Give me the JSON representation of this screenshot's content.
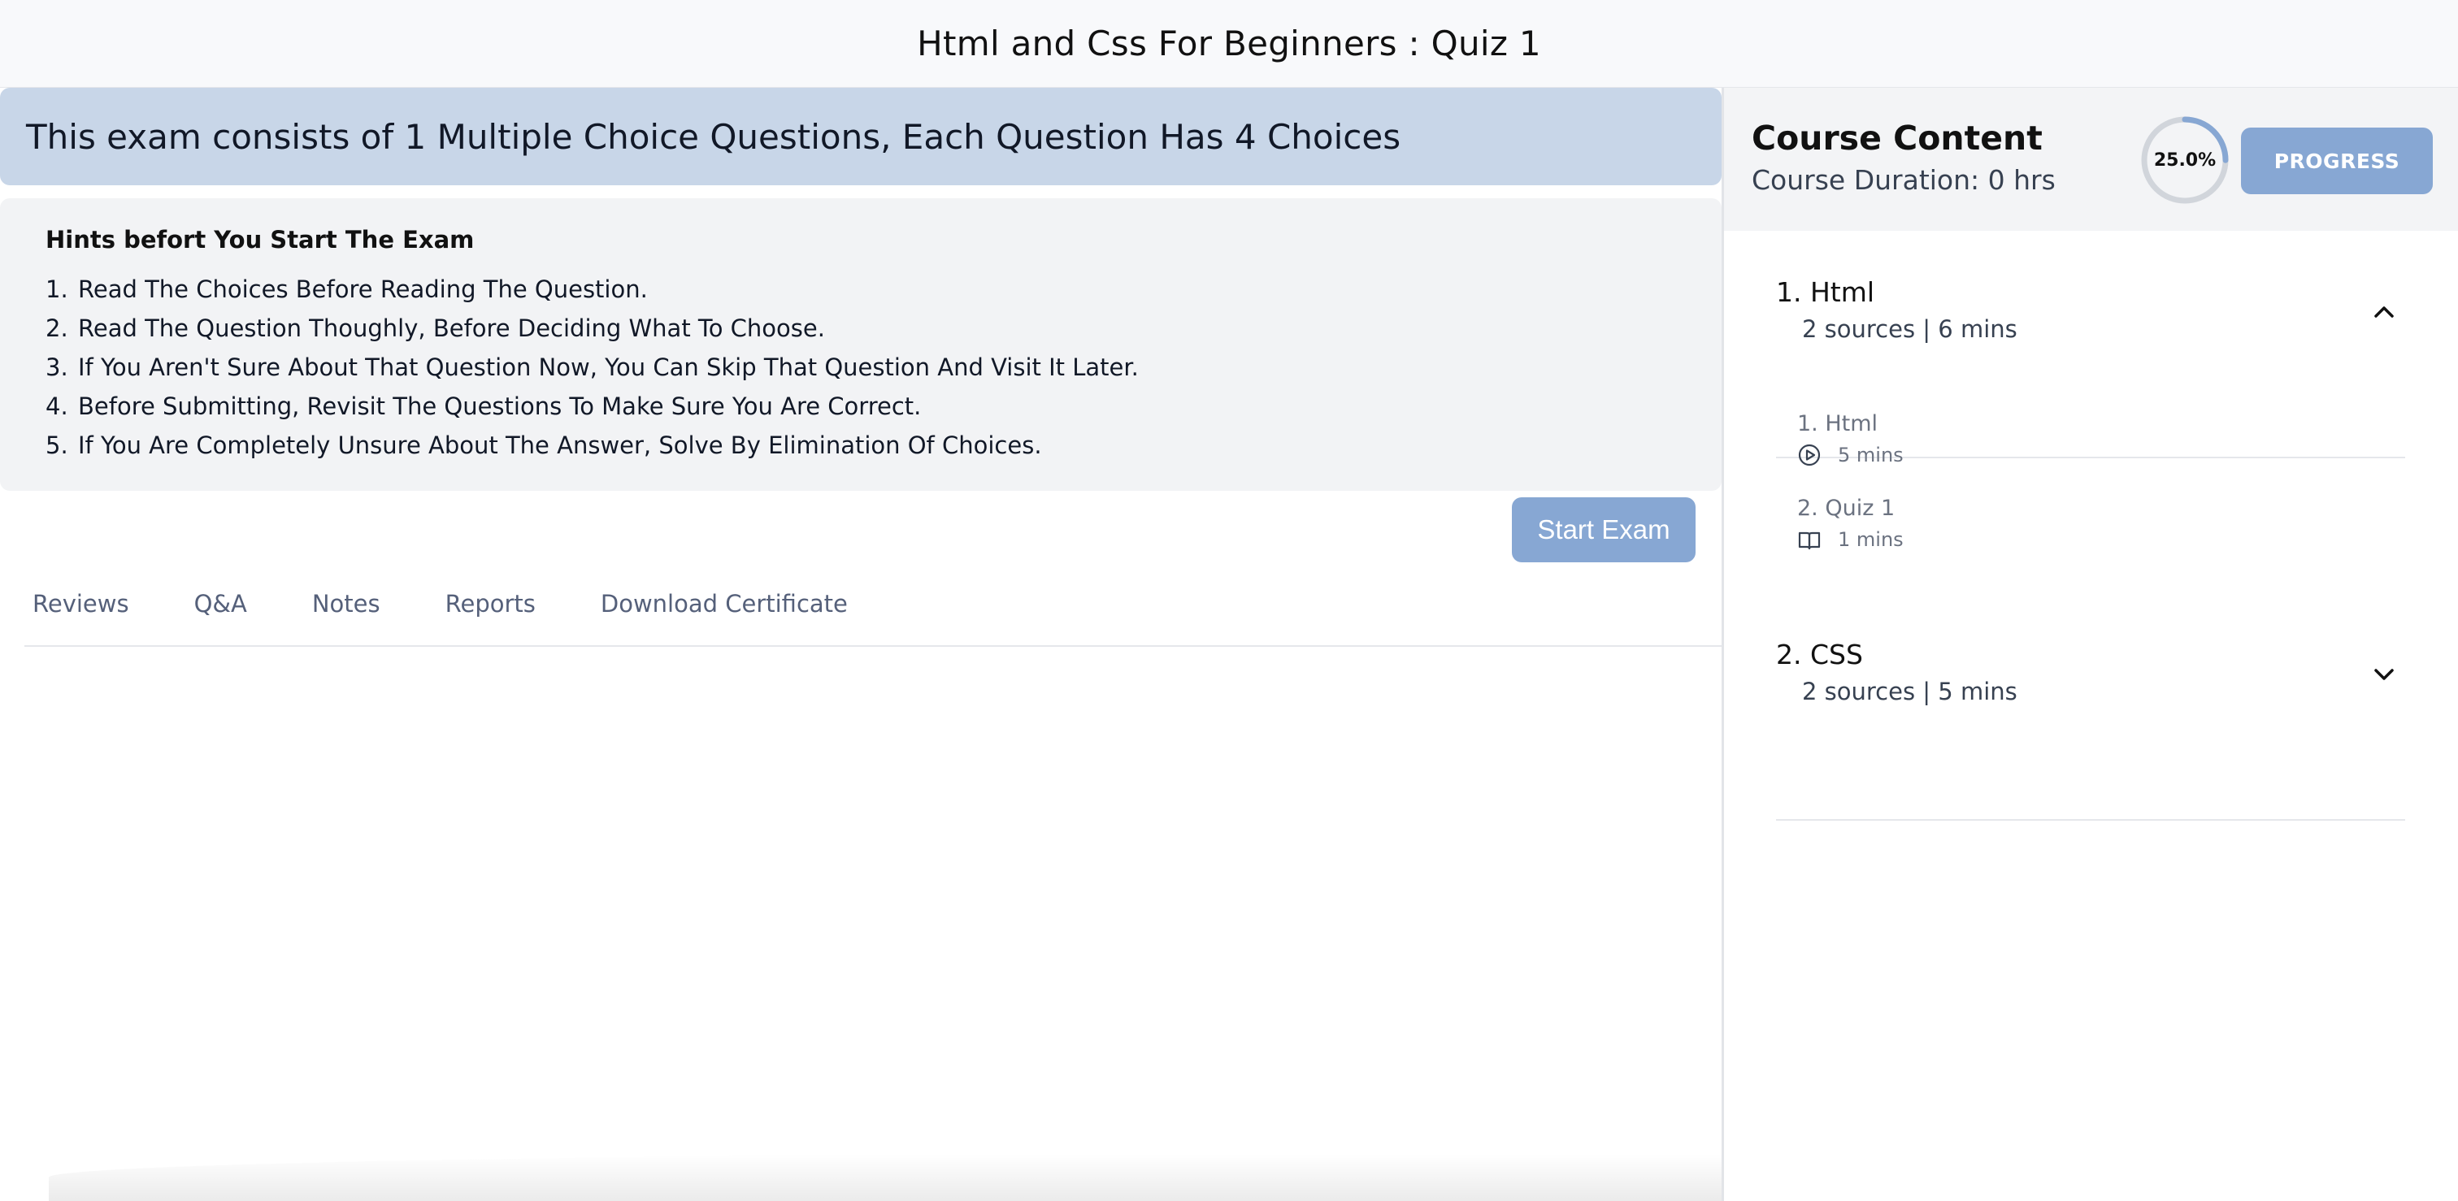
{
  "header": {
    "title": "Html and Css For Beginners : Quiz 1"
  },
  "exam": {
    "banner": "This exam consists of 1 Multiple Choice Questions, Each Question Has 4 Choices",
    "hints_title": "Hints befort You Start The Exam",
    "hints": [
      {
        "num": "1.",
        "text": "Read The Choices Before Reading The Question."
      },
      {
        "num": "2.",
        "text": "Read The Question Thoughly, Before Deciding What To Choose."
      },
      {
        "num": "3.",
        "text": "If You Aren't Sure About That Question Now, You Can Skip That Question And Visit It Later."
      },
      {
        "num": "4.",
        "text": "Before Submitting, Revisit The Questions To Make Sure You Are Correct."
      },
      {
        "num": "5.",
        "text": "If You Are Completely Unsure About The Answer, Solve By Elimination Of Choices."
      }
    ],
    "start_label": "Start Exam"
  },
  "tabs": [
    "Reviews",
    "Q&A",
    "Notes",
    "Reports",
    "Download Certificate"
  ],
  "sidebar": {
    "title": "Course Content",
    "duration": "Course Duration: 0 hrs",
    "progress_value": 0.25,
    "progress_label": "25.0%",
    "progress_button": "PROGRESS",
    "sections": [
      {
        "name": "1. Html",
        "meta": "2 sources | 6 mins",
        "expanded": true,
        "chevron_icon": "chevron-up-icon",
        "lectures": [
          {
            "name": "1. Html",
            "duration": "5 mins",
            "icon": "play-circle-icon"
          },
          {
            "name": "2. Quiz 1",
            "duration": "1 mins",
            "icon": "book-open-icon"
          }
        ]
      },
      {
        "name": "2. CSS",
        "meta": "2 sources | 5 mins",
        "expanded": false,
        "chevron_icon": "chevron-down-icon"
      }
    ]
  },
  "colors": {
    "accent": "#87a7d3",
    "banner_bg": "#c8d6e8",
    "hints_bg": "#f2f3f5",
    "ring_track": "#d1d5db"
  }
}
